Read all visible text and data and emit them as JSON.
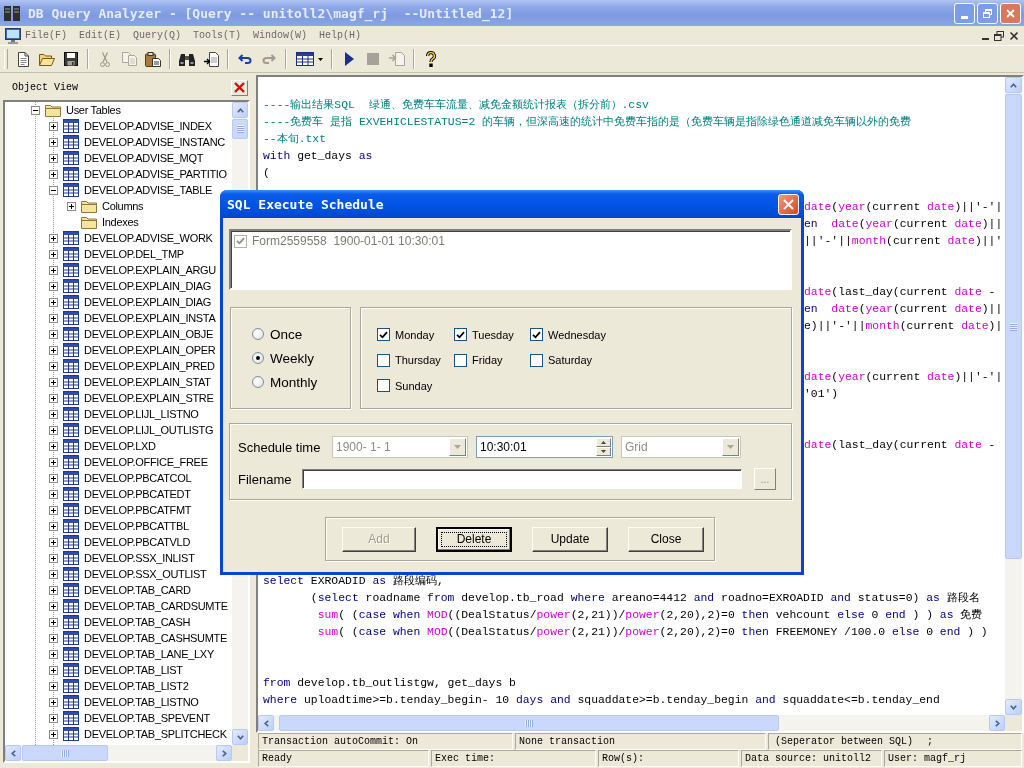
{
  "window": {
    "title": "DB Query Analyzer - [Query -- unitoll2\\magf_rj  --Untitled_12]",
    "active": false
  },
  "menu": [
    {
      "label": "File(F)",
      "disabled": true
    },
    {
      "label": "Edit(E)",
      "disabled": true
    },
    {
      "label": "Query(Q)",
      "disabled": true
    },
    {
      "label": "Tools(T)",
      "disabled": true
    },
    {
      "label": "Window(W)",
      "disabled": true
    },
    {
      "label": "Help(H)",
      "disabled": true
    }
  ],
  "toolbar": {
    "groups": [
      {
        "buttons": [
          {
            "kind": "new",
            "disabled": false
          },
          {
            "kind": "open",
            "disabled": false
          },
          {
            "kind": "save",
            "disabled": false
          }
        ]
      },
      {
        "buttons": [
          {
            "kind": "cut",
            "disabled": true
          },
          {
            "kind": "copy",
            "disabled": true
          },
          {
            "kind": "paste",
            "disabled": false
          }
        ]
      },
      {
        "buttons": [
          {
            "kind": "find",
            "disabled": false
          },
          {
            "kind": "replace",
            "disabled": false
          }
        ]
      },
      {
        "buttons": [
          {
            "kind": "undo",
            "disabled": false
          },
          {
            "kind": "redo",
            "disabled": true
          }
        ]
      },
      {
        "buttons": [
          {
            "kind": "grid",
            "disabled": false
          }
        ]
      },
      {
        "buttons": [
          {
            "kind": "run",
            "disabled": false
          },
          {
            "kind": "stop",
            "disabled": true
          },
          {
            "kind": "export",
            "disabled": true
          }
        ]
      },
      {
        "buttons": [
          {
            "kind": "help",
            "disabled": false
          }
        ]
      }
    ]
  },
  "object_view": {
    "title": "Object View",
    "tree": [
      {
        "label": "User Tables",
        "kind": "folder",
        "expanded": true,
        "children": [
          {
            "label": "DEVELOP.ADVISE_INDEX",
            "kind": "table",
            "expanded": false
          },
          {
            "label": "DEVELOP.ADVISE_INSTANC",
            "kind": "table",
            "expanded": false
          },
          {
            "label": "DEVELOP.ADVISE_MQT",
            "kind": "table",
            "expanded": false
          },
          {
            "label": "DEVELOP.ADVISE_PARTITIO",
            "kind": "table",
            "expanded": false
          },
          {
            "label": "DEVELOP.ADVISE_TABLE",
            "kind": "table",
            "expanded": true,
            "children": [
              {
                "label": "Columns",
                "kind": "folder",
                "expanded": false
              },
              {
                "label": "Indexes",
                "kind": "folder",
                "expanded": false,
                "expander": false
              }
            ]
          },
          {
            "label": "DEVELOP.ADVISE_WORK",
            "kind": "table",
            "expanded": false
          },
          {
            "label": "DEVELOP.DEL_TMP",
            "kind": "table",
            "expanded": false
          },
          {
            "label": "DEVELOP.EXPLAIN_ARGU",
            "kind": "table",
            "expanded": false
          },
          {
            "label": "DEVELOP.EXPLAIN_DIAG",
            "kind": "table",
            "expanded": false
          },
          {
            "label": "DEVELOP.EXPLAIN_DIAG",
            "kind": "table",
            "expanded": false
          },
          {
            "label": "DEVELOP.EXPLAIN_INSTA",
            "kind": "table",
            "expanded": false
          },
          {
            "label": "DEVELOP.EXPLAIN_OBJE",
            "kind": "table",
            "expanded": false
          },
          {
            "label": "DEVELOP.EXPLAIN_OPER",
            "kind": "table",
            "expanded": false
          },
          {
            "label": "DEVELOP.EXPLAIN_PRED",
            "kind": "table",
            "expanded": false
          },
          {
            "label": "DEVELOP.EXPLAIN_STAT",
            "kind": "table",
            "expanded": false
          },
          {
            "label": "DEVELOP.EXPLAIN_STRE",
            "kind": "table",
            "expanded": false
          },
          {
            "label": "DEVELOP.LIJL_LISTNO",
            "kind": "table",
            "expanded": false
          },
          {
            "label": "DEVELOP.LIJL_OUTLISTG",
            "kind": "table",
            "expanded": false
          },
          {
            "label": "DEVELOP.LXD",
            "kind": "table",
            "expanded": false
          },
          {
            "label": "DEVELOP.OFFICE_FREE",
            "kind": "table",
            "expanded": false
          },
          {
            "label": "DEVELOP.PBCATCOL",
            "kind": "table",
            "expanded": false
          },
          {
            "label": "DEVELOP.PBCATEDT",
            "kind": "table",
            "expanded": false
          },
          {
            "label": "DEVELOP.PBCATFMT",
            "kind": "table",
            "expanded": false
          },
          {
            "label": "DEVELOP.PBCATTBL",
            "kind": "table",
            "expanded": false
          },
          {
            "label": "DEVELOP.PBCATVLD",
            "kind": "table",
            "expanded": false
          },
          {
            "label": "DEVELOP.SSX_INLIST",
            "kind": "table",
            "expanded": false
          },
          {
            "label": "DEVELOP.SSX_OUTLIST",
            "kind": "table",
            "expanded": false
          },
          {
            "label": "DEVELOP.TAB_CARD",
            "kind": "table",
            "expanded": false
          },
          {
            "label": "DEVELOP.TAB_CARDSUMTE",
            "kind": "table",
            "expanded": false
          },
          {
            "label": "DEVELOP.TAB_CASH",
            "kind": "table",
            "expanded": false
          },
          {
            "label": "DEVELOP.TAB_CASHSUMTE",
            "kind": "table",
            "expanded": false
          },
          {
            "label": "DEVELOP.TAB_LANE_LXY",
            "kind": "table",
            "expanded": false
          },
          {
            "label": "DEVELOP.TAB_LIST",
            "kind": "table",
            "expanded": false
          },
          {
            "label": "DEVELOP.TAB_LIST2",
            "kind": "table",
            "expanded": false
          },
          {
            "label": "DEVELOP.TAB_LISTNO",
            "kind": "table",
            "expanded": false
          },
          {
            "label": "DEVELOP.TAB_SPEVENT",
            "kind": "table",
            "expanded": false
          },
          {
            "label": "DEVELOP.TAB_SPLITCHECK",
            "kind": "table",
            "expanded": false
          }
        ]
      }
    ]
  },
  "editor": {
    "lines": [
      {
        "kind": "blank"
      },
      {
        "kind": "code",
        "tokens": [
          {
            "text": "----输出结果SQL  绿通、免费车车流量、减免金额统计报表（拆分前）.csv",
            "kind": "comment"
          }
        ]
      },
      {
        "kind": "code",
        "tokens": [
          {
            "text": "----免费车 是指 EXVEHICLESTATUS=2 的车辆，但深高速的统计中免费车指的是（免费车辆是指除绿色通道减免车辆以外的免费",
            "kind": "comment"
          }
        ]
      },
      {
        "kind": "code",
        "tokens": [
          {
            "text": "--本旬.txt",
            "kind": "comment"
          }
        ]
      },
      {
        "kind": "code",
        "tokens": [
          {
            "text": "with",
            "kind": "keyword"
          },
          {
            "text": " get_days ",
            "kind": "plain"
          },
          {
            "text": "as",
            "kind": "keyword"
          }
        ]
      },
      {
        "kind": "code",
        "tokens": [
          {
            "text": "(",
            "kind": "plain"
          }
        ]
      },
      {
        "kind": "blank"
      },
      {
        "kind": "fragment",
        "tokens": [
          {
            "text": "date",
            "kind": "function"
          },
          {
            "text": "(",
            "kind": "plain"
          },
          {
            "text": "year",
            "kind": "function"
          },
          {
            "text": "(current ",
            "kind": "plain"
          },
          {
            "text": "date",
            "kind": "function"
          },
          {
            "text": ")||'-'|",
            "kind": "plain"
          }
        ]
      },
      {
        "kind": "fragment",
        "tokens": [
          {
            "text": "en  ",
            "kind": "keyword"
          },
          {
            "text": "date",
            "kind": "function"
          },
          {
            "text": "(",
            "kind": "plain"
          },
          {
            "text": "year",
            "kind": "function"
          },
          {
            "text": "(current ",
            "kind": "plain"
          },
          {
            "text": "date",
            "kind": "function"
          },
          {
            "text": ")||",
            "kind": "plain"
          }
        ]
      },
      {
        "kind": "fragment",
        "tokens": [
          {
            "text": "||'-'||",
            "kind": "plain"
          },
          {
            "text": "month",
            "kind": "function"
          },
          {
            "text": "(current ",
            "kind": "plain"
          },
          {
            "text": "date",
            "kind": "function"
          },
          {
            "text": ")||'",
            "kind": "plain"
          }
        ]
      },
      {
        "kind": "blank"
      },
      {
        "kind": "blank"
      },
      {
        "kind": "fragment",
        "tokens": [
          {
            "text": "date",
            "kind": "function"
          },
          {
            "text": "(last_day(current ",
            "kind": "plain"
          },
          {
            "text": "date",
            "kind": "function"
          },
          {
            "text": " -",
            "kind": "plain"
          }
        ]
      },
      {
        "kind": "fragment",
        "tokens": [
          {
            "text": "en  ",
            "kind": "keyword"
          },
          {
            "text": "date",
            "kind": "function"
          },
          {
            "text": "(",
            "kind": "plain"
          },
          {
            "text": "year",
            "kind": "function"
          },
          {
            "text": "(current ",
            "kind": "plain"
          },
          {
            "text": "date",
            "kind": "function"
          },
          {
            "text": ")||",
            "kind": "plain"
          }
        ]
      },
      {
        "kind": "fragment",
        "tokens": [
          {
            "text": "e)||'-'||",
            "kind": "plain"
          },
          {
            "text": "month",
            "kind": "function"
          },
          {
            "text": "(current ",
            "kind": "plain"
          },
          {
            "text": "date",
            "kind": "function"
          },
          {
            "text": ")|",
            "kind": "plain"
          }
        ]
      },
      {
        "kind": "blank"
      },
      {
        "kind": "blank"
      },
      {
        "kind": "fragment",
        "tokens": [
          {
            "text": "date",
            "kind": "function"
          },
          {
            "text": "(",
            "kind": "plain"
          },
          {
            "text": "year",
            "kind": "function"
          },
          {
            "text": "(current ",
            "kind": "plain"
          },
          {
            "text": "date",
            "kind": "function"
          },
          {
            "text": ")||'-'|",
            "kind": "plain"
          }
        ]
      },
      {
        "kind": "fragment",
        "tokens": [
          {
            "text": "'01')",
            "kind": "plain"
          }
        ]
      },
      {
        "kind": "blank"
      },
      {
        "kind": "blank"
      },
      {
        "kind": "fragment",
        "tokens": [
          {
            "text": "date",
            "kind": "function"
          },
          {
            "text": "(last_day(current ",
            "kind": "plain"
          },
          {
            "text": "date",
            "kind": "function"
          },
          {
            "text": " -",
            "kind": "plain"
          }
        ]
      },
      {
        "kind": "blank"
      },
      {
        "kind": "blank"
      },
      {
        "kind": "blank"
      },
      {
        "kind": "blank"
      },
      {
        "kind": "blank"
      },
      {
        "kind": "blank"
      },
      {
        "kind": "blank"
      },
      {
        "kind": "code",
        "tokens": [
          {
            "text": "select",
            "kind": "keyword"
          },
          {
            "text": " EXROADID ",
            "kind": "plain"
          },
          {
            "text": "as",
            "kind": "keyword"
          },
          {
            "text": " 路段编码,",
            "kind": "plain"
          }
        ]
      },
      {
        "kind": "code",
        "tokens": [
          {
            "text": "       (",
            "kind": "plain"
          },
          {
            "text": "select",
            "kind": "keyword"
          },
          {
            "text": " roadname ",
            "kind": "plain"
          },
          {
            "text": "from",
            "kind": "keyword"
          },
          {
            "text": " develop.tb_road ",
            "kind": "plain"
          },
          {
            "text": "where",
            "kind": "keyword"
          },
          {
            "text": " areano=4412 ",
            "kind": "plain"
          },
          {
            "text": "and",
            "kind": "keyword"
          },
          {
            "text": " roadno=EXROADID ",
            "kind": "plain"
          },
          {
            "text": "and",
            "kind": "keyword"
          },
          {
            "text": " status=0) ",
            "kind": "plain"
          },
          {
            "text": "as",
            "kind": "keyword"
          },
          {
            "text": " 路段名",
            "kind": "plain"
          }
        ]
      },
      {
        "kind": "code",
        "tokens": [
          {
            "text": "        sum",
            "kind": "function"
          },
          {
            "text": "( (",
            "kind": "plain"
          },
          {
            "text": "case ",
            "kind": "keyword"
          },
          {
            "text": "when ",
            "kind": "keyword"
          },
          {
            "text": "MOD",
            "kind": "function"
          },
          {
            "text": "((DealStatus/",
            "kind": "plain"
          },
          {
            "text": "power",
            "kind": "function"
          },
          {
            "text": "(2,21))/",
            "kind": "plain"
          },
          {
            "text": "power",
            "kind": "function"
          },
          {
            "text": "(2,20),2)=0 ",
            "kind": "plain"
          },
          {
            "text": "then",
            "kind": "keyword"
          },
          {
            "text": " vehcount ",
            "kind": "plain"
          },
          {
            "text": "else",
            "kind": "keyword"
          },
          {
            "text": " 0 ",
            "kind": "plain"
          },
          {
            "text": "end",
            "kind": "keyword"
          },
          {
            "text": " ) ) ",
            "kind": "plain"
          },
          {
            "text": "as",
            "kind": "keyword"
          },
          {
            "text": " 免费",
            "kind": "plain"
          }
        ]
      },
      {
        "kind": "code",
        "tokens": [
          {
            "text": "        sum",
            "kind": "function"
          },
          {
            "text": "( (",
            "kind": "plain"
          },
          {
            "text": "case ",
            "kind": "keyword"
          },
          {
            "text": "when ",
            "kind": "keyword"
          },
          {
            "text": "MOD",
            "kind": "function"
          },
          {
            "text": "((DealStatus/",
            "kind": "plain"
          },
          {
            "text": "power",
            "kind": "function"
          },
          {
            "text": "(2,21))/",
            "kind": "plain"
          },
          {
            "text": "power",
            "kind": "function"
          },
          {
            "text": "(2,20),2)=0 ",
            "kind": "plain"
          },
          {
            "text": "then",
            "kind": "keyword"
          },
          {
            "text": " FREEMONEY /100.0 ",
            "kind": "plain"
          },
          {
            "text": "else",
            "kind": "keyword"
          },
          {
            "text": " 0 ",
            "kind": "plain"
          },
          {
            "text": "end",
            "kind": "keyword"
          },
          {
            "text": " ) )",
            "kind": "plain"
          }
        ]
      },
      {
        "kind": "blank"
      },
      {
        "kind": "blank"
      },
      {
        "kind": "code",
        "tokens": [
          {
            "text": "from",
            "kind": "keyword"
          },
          {
            "text": " develop.tb_outlistgw, get_days b",
            "kind": "plain"
          }
        ]
      },
      {
        "kind": "code",
        "tokens": [
          {
            "text": "where",
            "kind": "keyword"
          },
          {
            "text": " uploadtime>=b.tenday_begin- 10 ",
            "kind": "plain"
          },
          {
            "text": "days ",
            "kind": "keyword"
          },
          {
            "text": "and",
            "kind": "keyword"
          },
          {
            "text": " squaddate>=b.tenday_begin ",
            "kind": "plain"
          },
          {
            "text": "and",
            "kind": "keyword"
          },
          {
            "text": " squaddate<=b.tenday_end",
            "kind": "plain"
          }
        ]
      }
    ]
  },
  "status_bar": {
    "rows": [
      {
        "panels": [
          {
            "texts": [
              "Transaction autoCommit: On"
            ]
          },
          {
            "texts": [
              "None transaction"
            ]
          },
          {
            "texts": [
              "(Seperator between SQL)",
              ";"
            ]
          }
        ]
      },
      {
        "panels": [
          {
            "texts": [
              "Ready"
            ]
          },
          {
            "texts": [
              "Exec time:"
            ]
          },
          {
            "texts": [
              "Row(s):"
            ]
          },
          {
            "texts": [
              "Data source: unitoll2"
            ]
          },
          {
            "texts": [
              "User: magf_rj"
            ]
          }
        ]
      }
    ]
  },
  "dialog": {
    "title": "SQL Execute Schedule",
    "active": true,
    "schedules": {
      "disabled": true,
      "items": [
        {
          "text": "Form2559558  1900-01-01 10:30:01",
          "checked": true
        }
      ]
    },
    "frequency": [
      {
        "label": "Once",
        "selected": false
      },
      {
        "label": "Weekly",
        "selected": true
      },
      {
        "label": "Monthly",
        "selected": false
      }
    ],
    "weekdays": [
      {
        "label": "Monday",
        "checked": true
      },
      {
        "label": "Tuesday",
        "checked": true
      },
      {
        "label": "Wednesday",
        "checked": true
      },
      {
        "label": "Thursday",
        "checked": false
      },
      {
        "label": "Friday",
        "checked": false
      },
      {
        "label": "Saturday",
        "checked": false
      },
      {
        "label": "Sunday",
        "checked": false
      }
    ],
    "schedule_time": {
      "label": "Schedule time",
      "date": {
        "value": "1900- 1- 1",
        "disabled": true
      },
      "time": {
        "value": "10:30:01"
      },
      "output": {
        "value": "Grid",
        "disabled": true
      }
    },
    "filename": {
      "label": "Filename",
      "browse": {
        "label": "...",
        "disabled": true
      }
    },
    "buttons": [
      {
        "label": "Add",
        "disabled": true,
        "focused": false
      },
      {
        "label": "Delete",
        "disabled": false,
        "focused": true
      },
      {
        "label": "Update",
        "disabled": false,
        "focused": false
      },
      {
        "label": "Close",
        "disabled": false,
        "focused": false
      }
    ]
  }
}
